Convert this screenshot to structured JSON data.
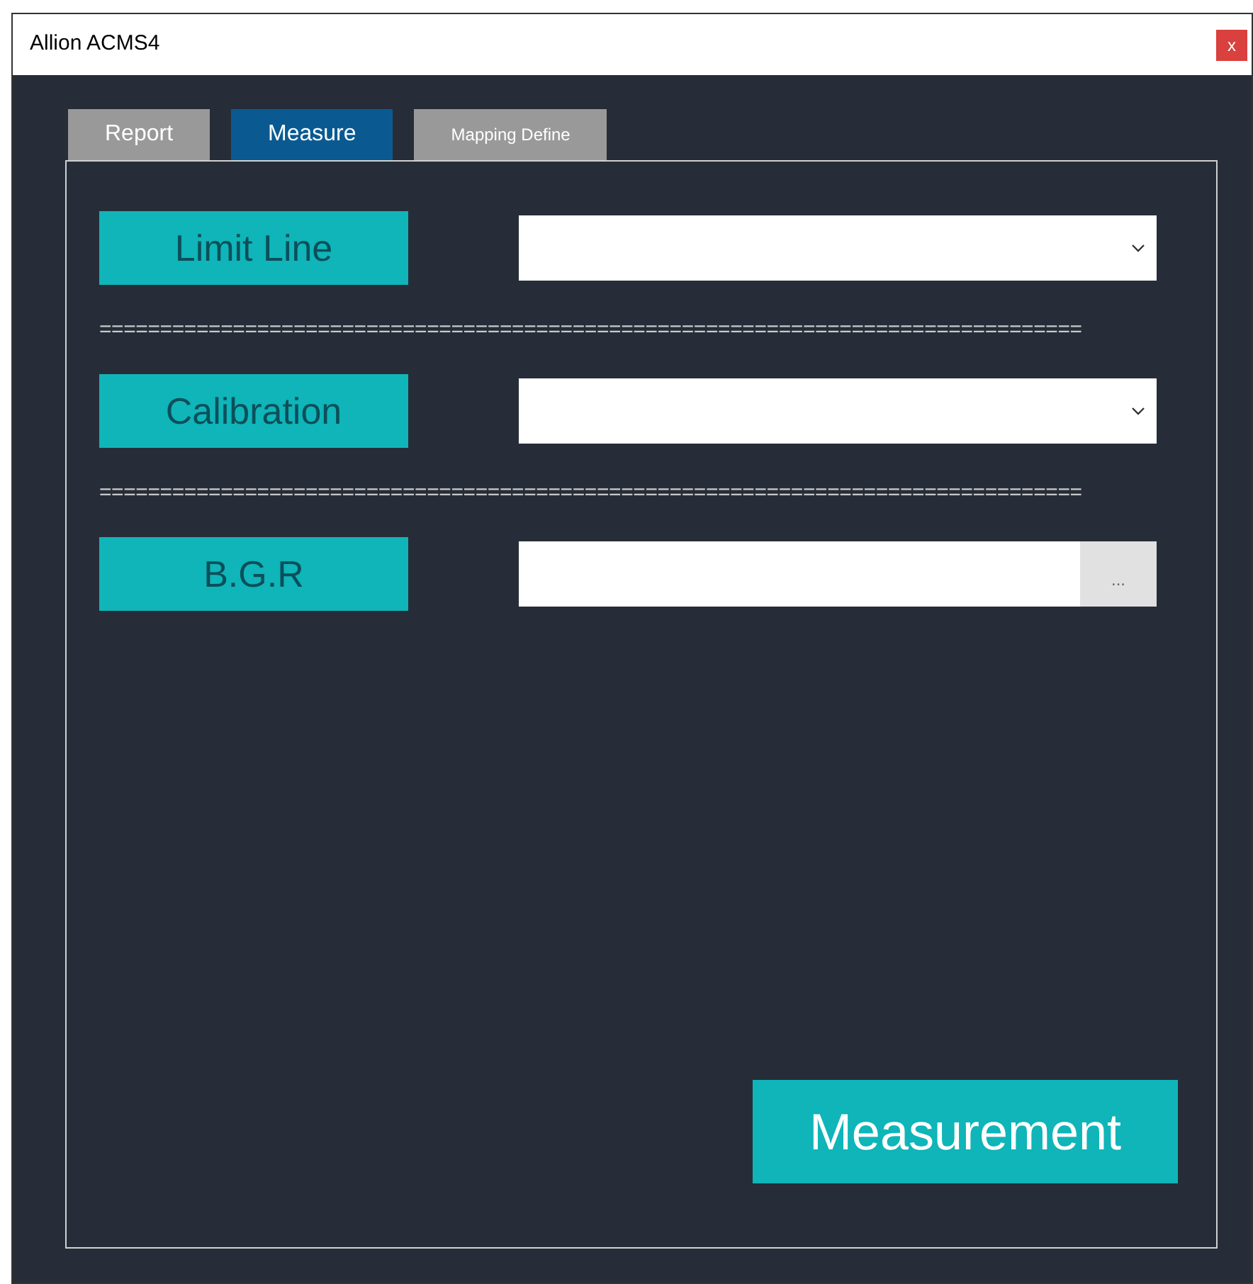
{
  "window": {
    "title": "Allion ACMS4",
    "close": "x"
  },
  "tabs": [
    {
      "label": "Report",
      "selected": false
    },
    {
      "label": "Measure",
      "selected": true
    },
    {
      "label": "Mapping Define",
      "selected": false
    }
  ],
  "rows": [
    {
      "kind": "dropdown",
      "label": "Limit Line"
    },
    {
      "kind": "separator",
      "text": "================================================================================="
    },
    {
      "kind": "dropdown",
      "label": "Calibration"
    },
    {
      "kind": "separator",
      "text": "================================================================================="
    },
    {
      "kind": "browse",
      "label": "B.G.R",
      "browse": "..."
    }
  ],
  "action": "Measurement"
}
